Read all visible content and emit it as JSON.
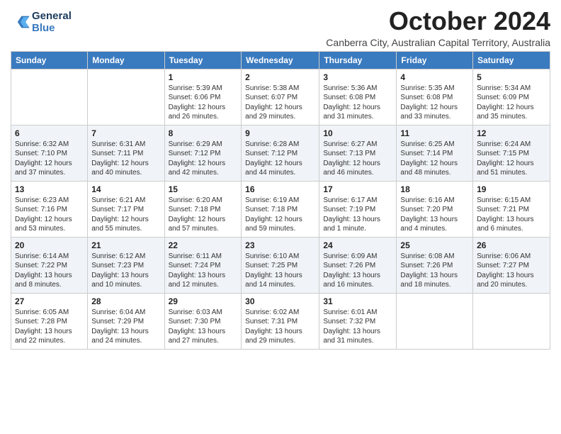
{
  "logo": {
    "line1": "General",
    "line2": "Blue"
  },
  "title": "October 2024",
  "subtitle": "Canberra City, Australian Capital Territory, Australia",
  "days_of_week": [
    "Sunday",
    "Monday",
    "Tuesday",
    "Wednesday",
    "Thursday",
    "Friday",
    "Saturday"
  ],
  "weeks": [
    [
      {
        "day": "",
        "info": ""
      },
      {
        "day": "",
        "info": ""
      },
      {
        "day": "1",
        "info": "Sunrise: 5:39 AM\nSunset: 6:06 PM\nDaylight: 12 hours and 26 minutes."
      },
      {
        "day": "2",
        "info": "Sunrise: 5:38 AM\nSunset: 6:07 PM\nDaylight: 12 hours and 29 minutes."
      },
      {
        "day": "3",
        "info": "Sunrise: 5:36 AM\nSunset: 6:08 PM\nDaylight: 12 hours and 31 minutes."
      },
      {
        "day": "4",
        "info": "Sunrise: 5:35 AM\nSunset: 6:08 PM\nDaylight: 12 hours and 33 minutes."
      },
      {
        "day": "5",
        "info": "Sunrise: 5:34 AM\nSunset: 6:09 PM\nDaylight: 12 hours and 35 minutes."
      }
    ],
    [
      {
        "day": "6",
        "info": "Sunrise: 6:32 AM\nSunset: 7:10 PM\nDaylight: 12 hours and 37 minutes."
      },
      {
        "day": "7",
        "info": "Sunrise: 6:31 AM\nSunset: 7:11 PM\nDaylight: 12 hours and 40 minutes."
      },
      {
        "day": "8",
        "info": "Sunrise: 6:29 AM\nSunset: 7:12 PM\nDaylight: 12 hours and 42 minutes."
      },
      {
        "day": "9",
        "info": "Sunrise: 6:28 AM\nSunset: 7:12 PM\nDaylight: 12 hours and 44 minutes."
      },
      {
        "day": "10",
        "info": "Sunrise: 6:27 AM\nSunset: 7:13 PM\nDaylight: 12 hours and 46 minutes."
      },
      {
        "day": "11",
        "info": "Sunrise: 6:25 AM\nSunset: 7:14 PM\nDaylight: 12 hours and 48 minutes."
      },
      {
        "day": "12",
        "info": "Sunrise: 6:24 AM\nSunset: 7:15 PM\nDaylight: 12 hours and 51 minutes."
      }
    ],
    [
      {
        "day": "13",
        "info": "Sunrise: 6:23 AM\nSunset: 7:16 PM\nDaylight: 12 hours and 53 minutes."
      },
      {
        "day": "14",
        "info": "Sunrise: 6:21 AM\nSunset: 7:17 PM\nDaylight: 12 hours and 55 minutes."
      },
      {
        "day": "15",
        "info": "Sunrise: 6:20 AM\nSunset: 7:18 PM\nDaylight: 12 hours and 57 minutes."
      },
      {
        "day": "16",
        "info": "Sunrise: 6:19 AM\nSunset: 7:18 PM\nDaylight: 12 hours and 59 minutes."
      },
      {
        "day": "17",
        "info": "Sunrise: 6:17 AM\nSunset: 7:19 PM\nDaylight: 13 hours and 1 minute."
      },
      {
        "day": "18",
        "info": "Sunrise: 6:16 AM\nSunset: 7:20 PM\nDaylight: 13 hours and 4 minutes."
      },
      {
        "day": "19",
        "info": "Sunrise: 6:15 AM\nSunset: 7:21 PM\nDaylight: 13 hours and 6 minutes."
      }
    ],
    [
      {
        "day": "20",
        "info": "Sunrise: 6:14 AM\nSunset: 7:22 PM\nDaylight: 13 hours and 8 minutes."
      },
      {
        "day": "21",
        "info": "Sunrise: 6:12 AM\nSunset: 7:23 PM\nDaylight: 13 hours and 10 minutes."
      },
      {
        "day": "22",
        "info": "Sunrise: 6:11 AM\nSunset: 7:24 PM\nDaylight: 13 hours and 12 minutes."
      },
      {
        "day": "23",
        "info": "Sunrise: 6:10 AM\nSunset: 7:25 PM\nDaylight: 13 hours and 14 minutes."
      },
      {
        "day": "24",
        "info": "Sunrise: 6:09 AM\nSunset: 7:26 PM\nDaylight: 13 hours and 16 minutes."
      },
      {
        "day": "25",
        "info": "Sunrise: 6:08 AM\nSunset: 7:26 PM\nDaylight: 13 hours and 18 minutes."
      },
      {
        "day": "26",
        "info": "Sunrise: 6:06 AM\nSunset: 7:27 PM\nDaylight: 13 hours and 20 minutes."
      }
    ],
    [
      {
        "day": "27",
        "info": "Sunrise: 6:05 AM\nSunset: 7:28 PM\nDaylight: 13 hours and 22 minutes."
      },
      {
        "day": "28",
        "info": "Sunrise: 6:04 AM\nSunset: 7:29 PM\nDaylight: 13 hours and 24 minutes."
      },
      {
        "day": "29",
        "info": "Sunrise: 6:03 AM\nSunset: 7:30 PM\nDaylight: 13 hours and 27 minutes."
      },
      {
        "day": "30",
        "info": "Sunrise: 6:02 AM\nSunset: 7:31 PM\nDaylight: 13 hours and 29 minutes."
      },
      {
        "day": "31",
        "info": "Sunrise: 6:01 AM\nSunset: 7:32 PM\nDaylight: 13 hours and 31 minutes."
      },
      {
        "day": "",
        "info": ""
      },
      {
        "day": "",
        "info": ""
      }
    ]
  ]
}
